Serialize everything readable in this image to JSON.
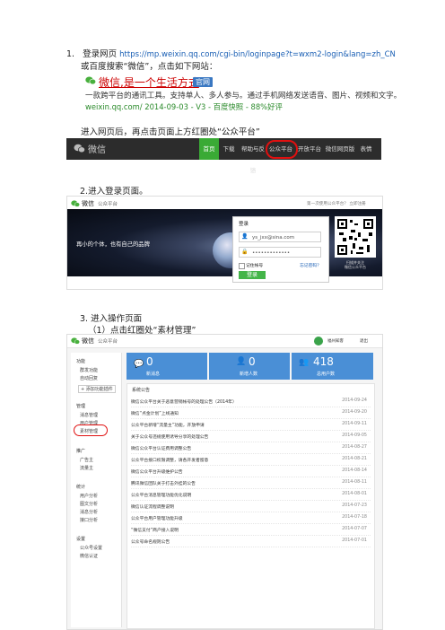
{
  "step1": {
    "number": "1.",
    "text_prefix": "登录网页",
    "url": "https://mp.weixin.qq.com/cgi-bin/loginpage?t=wxm2-login&lang=zh_CN",
    "line2": "或百度搜索“微信”，点击如下网站：",
    "search_result": {
      "title": "微信,是一个生活方式",
      "badge": "官网",
      "desc": "一款跨平台的通讯工具。支持单人、多人参与。通过手机网络发送语音、图片、视频和文字。",
      "meta": "weixin.qq.com/ 2014-09-03  -  V3  -  百度快照  -  88%好评"
    },
    "line3": "进入网页后，再点击页面上方红圈处“公众平台”",
    "nav": {
      "logo_text": "微信",
      "items": [
        "首页",
        "下载",
        "帮助与反馈",
        "公众平台",
        "开放平台",
        "微信网页版",
        "表情"
      ],
      "active_index": 0,
      "highlight_index": 3
    }
  },
  "step2": {
    "title": "2.进入登录页面。",
    "header": {
      "logo": "微信",
      "sub": "公众平台"
    },
    "header_right": "第一次使用公众平台？ 立即注册",
    "slogan": "再小的个体，也有自己的品牌",
    "login": {
      "title": "登录",
      "email": "ys_jxx@sina.com",
      "password": "•••••••••••••",
      "remember": "记住帐号",
      "forgot": "忘记密码？",
      "button": "登录"
    },
    "qr_caption": "扫描并关注\n微信公众平台"
  },
  "step3": {
    "title": "3.   进入操作页面",
    "subtitle": "（1）点击红圈处“素材管理”",
    "header": {
      "logo": "微信",
      "sub": "公众平台",
      "account": "福州知客",
      "logout": "退出"
    },
    "sidebar": [
      {
        "group": "功能",
        "items": [
          "群发功能",
          "自动回复",
          "+ 添加功能插件"
        ]
      },
      {
        "group": "管理",
        "items": [
          "消息管理",
          "用户管理",
          "素材管理"
        ]
      },
      {
        "group": "推广",
        "items": [
          "广告主",
          "流量主"
        ]
      },
      {
        "group": "统计",
        "items": [
          "用户分析",
          "图文分析",
          "消息分析",
          "接口分析"
        ]
      },
      {
        "group": "设置",
        "items": [
          "公众号设置",
          "微信认证"
        ]
      }
    ],
    "stats": [
      {
        "num": "0",
        "label": "新消息"
      },
      {
        "num": "0",
        "label": "新增人数"
      },
      {
        "num": "418",
        "label": "总用户数"
      }
    ],
    "notice_title": "系统公告",
    "notices": [
      {
        "title": "微信公众平台关于恶意营销帐号的处理公告（2014年）",
        "date": "2014-09-24"
      },
      {
        "title": "微信“点金计划”上线通知",
        "date": "2014-09-20"
      },
      {
        "title": "公众平台新增“流量主”功能，开放申请",
        "date": "2014-09-11"
      },
      {
        "title": "关于公众号违规使用诱导分享的处理公告",
        "date": "2014-09-05"
      },
      {
        "title": "微信公众平台认证费用调整公告",
        "date": "2014-08-27"
      },
      {
        "title": "公众平台接口权限调整，请各开发者留意",
        "date": "2014-08-21"
      },
      {
        "title": "微信公众平台升级维护公告",
        "date": "2014-08-14"
      },
      {
        "title": "腾讯微信团队关于打击外挂的公告",
        "date": "2014-08-11"
      },
      {
        "title": "公众平台消息管理功能优化说明",
        "date": "2014-08-01"
      },
      {
        "title": "微信认证流程调整说明",
        "date": "2014-07-23"
      },
      {
        "title": "公众平台用户管理功能升级",
        "date": "2014-07-18"
      },
      {
        "title": "“微信支付”商户接入说明",
        "date": "2014-07-07"
      },
      {
        "title": "公众号命名规则公告",
        "date": "2014-07-01"
      }
    ]
  }
}
